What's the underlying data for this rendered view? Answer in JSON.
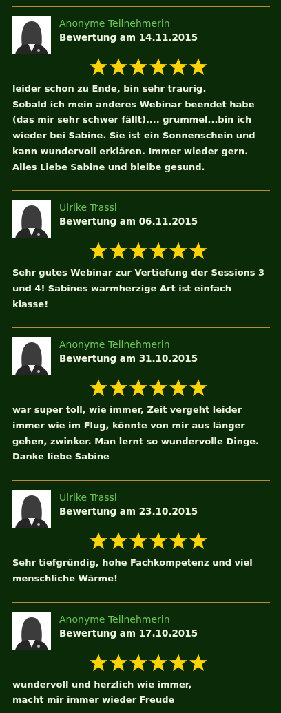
{
  "reviews": [
    {
      "author": "Anonyme Teilnehmerin",
      "date": "Bewertung am 14.11.2015",
      "stars": 6,
      "text": "leider schon zu Ende, bin sehr traurig.\nSobald ich mein anderes Webinar beendet habe (das mir sehr schwer fällt).... grummel...bin ich wieder bei Sabine. Sie ist ein Sonnenschein und kann wundervoll erklären. Immer wieder gern. Alles Liebe Sabine und bleibe gesund."
    },
    {
      "author": "Ulrike Trassl",
      "date": "Bewertung am 06.11.2015",
      "stars": 6,
      "text": "Sehr gutes Webinar zur Vertiefung der Sessions 3 und 4! Sabines warmherzige Art ist einfach klasse!"
    },
    {
      "author": "Anonyme Teilnehmerin",
      "date": "Bewertung am 31.10.2015",
      "stars": 6,
      "text": "war super toll, wie immer, Zeit vergeht leider immer wie im Flug, könnte von mir aus länger gehen, zwinker. Man lernt so wundervolle Dinge. Danke liebe Sabine"
    },
    {
      "author": "Ulrike Trassl",
      "date": "Bewertung am 23.10.2015",
      "stars": 6,
      "text": "Sehr tiefgründig, hohe Fachkompetenz und viel menschliche Wärme!"
    },
    {
      "author": "Anonyme Teilnehmerin",
      "date": "Bewertung am 17.10.2015",
      "stars": 6,
      "text": "wundervoll und herzlich wie immer,\nmacht mir immer wieder Freude"
    }
  ]
}
